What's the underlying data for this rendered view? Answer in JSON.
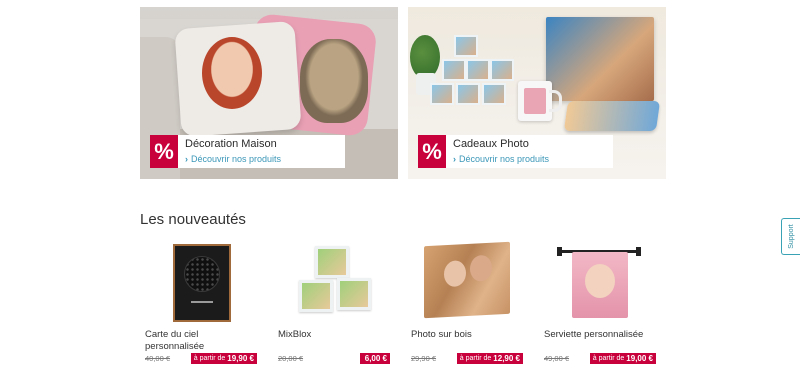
{
  "banners": [
    {
      "title": "Décoration Maison",
      "link": "Découvrir nos produits",
      "badge": "%"
    },
    {
      "title": "Cadeaux Photo",
      "link": "Découvrir nos produits",
      "badge": "%"
    }
  ],
  "section_title": "Les nouveautés",
  "products": [
    {
      "name": "Carte du ciel personnalisée",
      "old_price": "40,00 €",
      "prefix": "à partir de",
      "price": "19,90 €"
    },
    {
      "name": "MixBlox",
      "old_price": "20,00 €",
      "prefix": "",
      "price": "6,00 €"
    },
    {
      "name": "Photo sur bois",
      "old_price": "29,90 €",
      "prefix": "à partir de",
      "price": "12,90 €"
    },
    {
      "name": "Serviette personnalisée",
      "old_price": "49,00 €",
      "prefix": "à partir de",
      "price": "19,00 €"
    }
  ],
  "support_label": "Support",
  "colors": {
    "accent": "#c8003c",
    "link": "#3b97b8",
    "support": "#3aa2b5"
  }
}
